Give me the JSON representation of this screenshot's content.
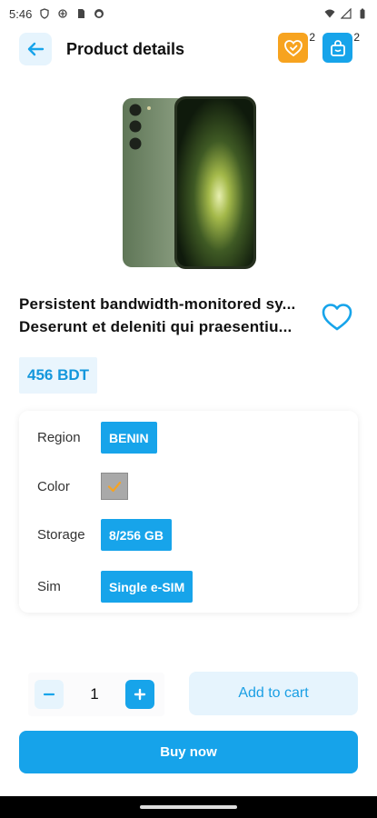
{
  "status_bar": {
    "time": "5:46",
    "icons": [
      "shield-icon",
      "data-saver-icon",
      "sim-card-icon",
      "face-icon",
      "wifi-icon",
      "signal-icon",
      "battery-icon"
    ]
  },
  "header": {
    "title": "Product details",
    "back_icon": "arrow-left-icon",
    "wishlist_icon": "heart-check-icon",
    "wishlist_count": "2",
    "cart_icon": "shopping-bag-icon",
    "cart_count": "2",
    "accent_color": "#17a4ea",
    "wishlist_color": "#f7a31f"
  },
  "product": {
    "image_icon": "smartphone-image",
    "name_line1": "Persistent bandwidth-monitored sy...",
    "name_line2": "Deserunt et deleniti qui praesentiu...",
    "favorite_icon": "heart-outline-icon",
    "price": "456 BDT"
  },
  "variants": [
    {
      "label": "Region",
      "value": "BENIN"
    },
    {
      "label": "Color",
      "value": ""
    },
    {
      "label": "Storage",
      "value": "8/256 GB"
    },
    {
      "label": "Sim",
      "value": "Single e-SIM"
    }
  ],
  "color_swatch": {
    "color": "#a9a9a9",
    "selected": true
  },
  "quantity": {
    "value": "1",
    "minus_icon": "minus-icon",
    "plus_icon": "plus-icon"
  },
  "actions": {
    "add_to_cart": "Add to cart",
    "buy_now": "Buy now"
  }
}
